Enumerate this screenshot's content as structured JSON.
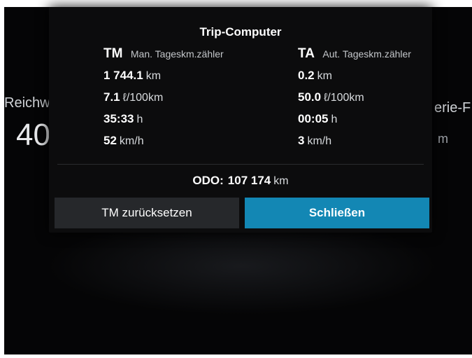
{
  "background": {
    "left_label": "Reichw",
    "left_value": "40",
    "right_label": "erie-F",
    "right_value": "m"
  },
  "dialog": {
    "title": "Trip-Computer",
    "left": {
      "code": "TM",
      "description": "Man. Tageskm.zähler",
      "rows": [
        {
          "value": "1 744.1",
          "unit": "km"
        },
        {
          "value": "7.1",
          "unit": "ℓ/100km"
        },
        {
          "value": "35:33",
          "unit": "h"
        },
        {
          "value": "52",
          "unit": "km/h"
        }
      ]
    },
    "right": {
      "code": "TA",
      "description": "Aut. Tageskm.zähler",
      "rows": [
        {
          "value": "0.2",
          "unit": "km"
        },
        {
          "value": "50.0",
          "unit": "ℓ/100km"
        },
        {
          "value": "00:05",
          "unit": "h"
        },
        {
          "value": "3",
          "unit": "km/h"
        }
      ]
    },
    "odo": {
      "label": "ODO:",
      "value": "107 174",
      "unit": "km"
    },
    "buttons": {
      "reset": "TM zurücksetzen",
      "close": "Schließen"
    }
  },
  "colors": {
    "accent": "#1387b4",
    "secondary_button": "#26282b",
    "dialog_background": "#0c0c0d"
  }
}
